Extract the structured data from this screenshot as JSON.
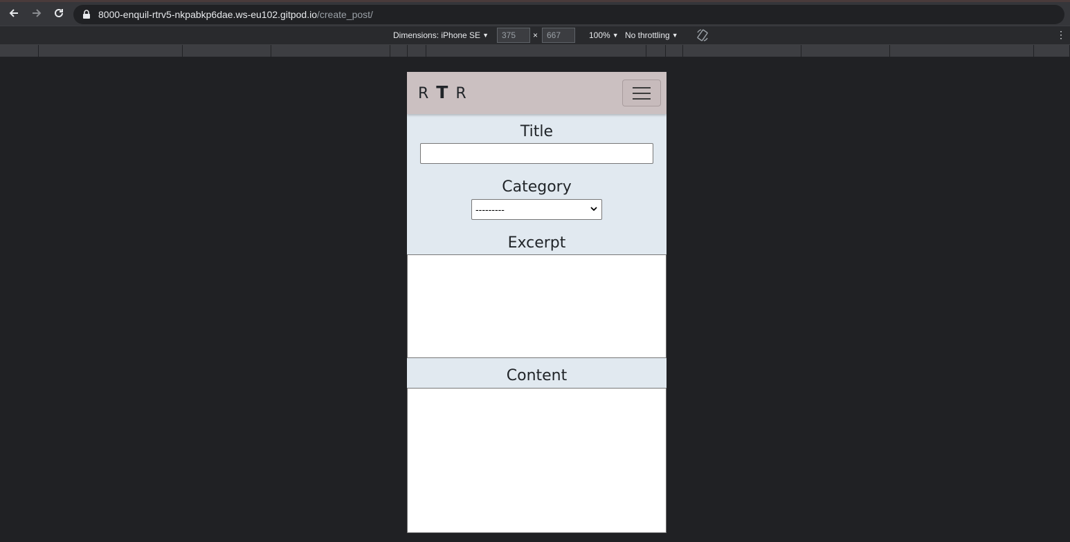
{
  "browser": {
    "url_host": "8000-enquil-rtrv5-nkpabkp6dae.ws-eu102.gitpod.io",
    "url_path": "/create_post/"
  },
  "device_toolbar": {
    "dimensions_label": "Dimensions: iPhone SE",
    "width": "375",
    "times": "×",
    "height": "667",
    "zoom": "100%",
    "throttling": "No throttling"
  },
  "site": {
    "brand_left": "R",
    "brand_mid": "T",
    "brand_right": "R"
  },
  "form": {
    "title_label": "Title",
    "title_value": "",
    "category_label": "Category",
    "category_selected": "---------",
    "excerpt_label": "Excerpt",
    "excerpt_value": "",
    "content_label": "Content",
    "content_value": ""
  },
  "colors": {
    "navbar": "#cbc0c1",
    "page_bg": "#e1e9f0",
    "devtools_bg": "#202124"
  }
}
